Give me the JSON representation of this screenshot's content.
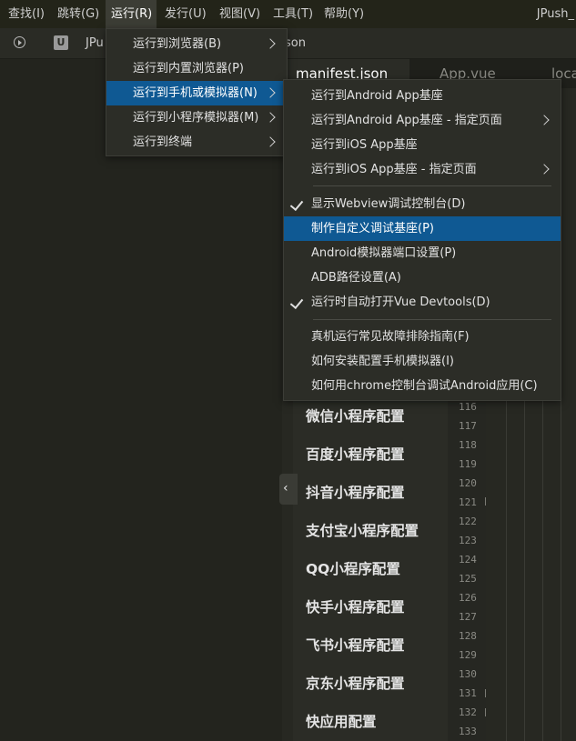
{
  "menubar": {
    "items": [
      {
        "label": "查找(I)"
      },
      {
        "label": "跳转(G)"
      },
      {
        "label": "运行(R)"
      },
      {
        "label": "发行(U)"
      },
      {
        "label": "视图(V)"
      },
      {
        "label": "工具(T)"
      },
      {
        "label": "帮助(Y)"
      }
    ],
    "window_title": "JPush_"
  },
  "toolbar": {
    "project_icon_letter": "U",
    "breadcrumb_project": "JPu",
    "breadcrumb_file": "son"
  },
  "tabs": [
    {
      "label": "manifest.json"
    },
    {
      "label": "App.vue"
    },
    {
      "label": "loca"
    }
  ],
  "outline": {
    "items": [
      "微信小程序配置",
      "百度小程序配置",
      "抖音小程序配置",
      "支付宝小程序配置",
      "QQ小程序配置",
      "快手小程序配置",
      "飞书小程序配置",
      "京东小程序配置",
      "快应用配置"
    ],
    "collapse_glyph": "‹"
  },
  "gutter": {
    "line_numbers": [
      "116",
      "117",
      "118",
      "119",
      "120",
      "121",
      "122",
      "123",
      "124",
      "125",
      "126",
      "127",
      "128",
      "129",
      "130",
      "131",
      "132",
      "133"
    ],
    "fold_lines": [
      "121",
      "131",
      "132"
    ]
  },
  "run_menu": {
    "items": [
      {
        "label": "运行到浏览器(B)",
        "submenu": true
      },
      {
        "label": "运行到内置浏览器(P)",
        "submenu": false
      },
      {
        "label": "运行到手机或模拟器(N)",
        "submenu": true,
        "highlighted": true
      },
      {
        "label": "运行到小程序模拟器(M)",
        "submenu": true
      },
      {
        "label": "运行到终端",
        "submenu": true
      }
    ]
  },
  "device_submenu": {
    "items": [
      {
        "label": "运行到Android App基座",
        "submenu": false,
        "checked": false
      },
      {
        "label": "运行到Android App基座 - 指定页面",
        "submenu": true,
        "checked": false
      },
      {
        "label": "运行到iOS App基座",
        "submenu": false,
        "checked": false
      },
      {
        "label": "运行到iOS App基座 - 指定页面",
        "submenu": true,
        "checked": false
      },
      {
        "separator": true
      },
      {
        "label": "显示Webview调试控制台(D)",
        "submenu": false,
        "checked": true
      },
      {
        "label": "制作自定义调试基座(P)",
        "submenu": false,
        "checked": false,
        "highlighted": true
      },
      {
        "label": "Android模拟器端口设置(P)",
        "submenu": false,
        "checked": false
      },
      {
        "label": "ADB路径设置(A)",
        "submenu": false,
        "checked": false
      },
      {
        "label": "运行时自动打开Vue Devtools(D)",
        "submenu": false,
        "checked": true
      },
      {
        "separator": true
      },
      {
        "label": "真机运行常见故障排除指南(F)",
        "submenu": false,
        "checked": false
      },
      {
        "label": "如何安装配置手机模拟器(I)",
        "submenu": false,
        "checked": false
      },
      {
        "label": "如何用chrome控制台调试Android应用(C)",
        "submenu": false,
        "checked": false
      }
    ]
  },
  "colors": {
    "highlight": "#0f5993",
    "menu_bg": "#2c2d27",
    "editor_bg": "#272822"
  }
}
